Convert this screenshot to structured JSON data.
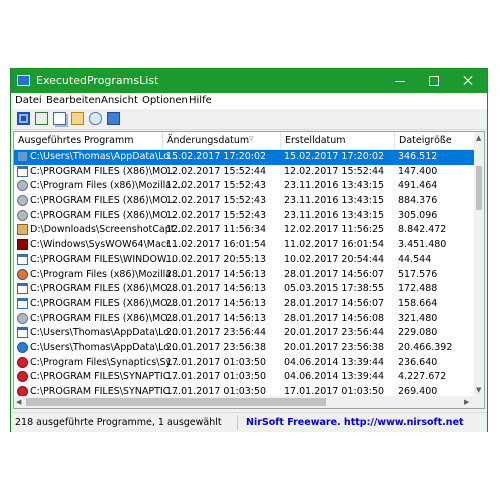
{
  "window": {
    "title": "ExecutedProgramsList"
  },
  "menu": [
    "Datei",
    "Bearbeiten",
    "Ansicht",
    "Optionen",
    "Hilfe"
  ],
  "toolbar": [
    "save-icon",
    "refresh-icon",
    "copy-icon",
    "properties-icon",
    "find-icon",
    "exit-icon"
  ],
  "columns": [
    "Ausgeführtes Programm",
    "Änderungsdatum",
    "Erstelldatum",
    "Dateigröße"
  ],
  "rows": [
    {
      "icon": "folder-icon",
      "name": "C:\\Users\\Thomas\\AppData\\Lo...",
      "modified": "15.02.2017 17:20:02",
      "created": "15.02.2017 17:20:02",
      "size": "346.512",
      "selected": true
    },
    {
      "icon": "window-icon",
      "name": "C:\\PROGRAM FILES (X86)\\MO...",
      "modified": "12.02.2017 15:52:44",
      "created": "12.02.2017 15:52:44",
      "size": "147.400"
    },
    {
      "icon": "gear-icon",
      "name": "C:\\Program Files (x86)\\Mozilla ...",
      "modified": "12.02.2017 15:52:43",
      "created": "23.11.2016 13:43:15",
      "size": "491.464"
    },
    {
      "icon": "gear-icon",
      "name": "C:\\PROGRAM FILES (X86)\\MO...",
      "modified": "12.02.2017 15:52:43",
      "created": "23.11.2016 13:43:15",
      "size": "884.376"
    },
    {
      "icon": "gear-icon",
      "name": "C:\\PROGRAM FILES (X86)\\MO...",
      "modified": "12.02.2017 15:52:43",
      "created": "23.11.2016 13:43:15",
      "size": "305.096"
    },
    {
      "icon": "setup-icon",
      "name": "D:\\Downloads\\ScreenshotCapt...",
      "modified": "12.02.2017 11:56:34",
      "created": "12.02.2017 11:56:25",
      "size": "8.842.472"
    },
    {
      "icon": "macromedia-icon",
      "name": "C:\\Windows\\SysWOW64\\Macr...",
      "modified": "11.02.2017 16:01:54",
      "created": "11.02.2017 16:01:54",
      "size": "3.451.480"
    },
    {
      "icon": "window-icon",
      "name": "C:\\PROGRAM FILES\\WINDOW...",
      "modified": "10.02.2017 20:55:13",
      "created": "10.02.2017 20:54:44",
      "size": "44.544"
    },
    {
      "icon": "firefox-icon",
      "name": "C:\\Program Files (x86)\\Mozilla ...",
      "modified": "28.01.2017 14:56:13",
      "created": "28.01.2017 14:56:07",
      "size": "517.576"
    },
    {
      "icon": "window-icon",
      "name": "C:\\PROGRAM FILES (X86)\\MO...",
      "modified": "28.01.2017 14:56:13",
      "created": "05.03.2015 17:38:55",
      "size": "172.488"
    },
    {
      "icon": "window-icon",
      "name": "C:\\PROGRAM FILES (X86)\\MO...",
      "modified": "28.01.2017 14:56:13",
      "created": "28.01.2017 14:56:07",
      "size": "158.664"
    },
    {
      "icon": "gear-icon",
      "name": "C:\\PROGRAM FILES (X86)\\MO...",
      "modified": "28.01.2017 14:56:13",
      "created": "28.01.2017 14:56:08",
      "size": "321.480"
    },
    {
      "icon": "window-icon",
      "name": "C:\\Users\\Thomas\\AppData\\Lo...",
      "modified": "20.01.2017 23:56:44",
      "created": "20.01.2017 23:56:44",
      "size": "229.080"
    },
    {
      "icon": "cloud-icon",
      "name": "C:\\Users\\Thomas\\AppData\\Lo...",
      "modified": "20.01.2017 23:56:38",
      "created": "20.01.2017 23:56:38",
      "size": "20.466.392"
    },
    {
      "icon": "synaptics-icon",
      "name": "C:\\Program Files\\Synaptics\\Sy...",
      "modified": "17.01.2017 01:03:50",
      "created": "04.06.2014 13:39:44",
      "size": "236.640"
    },
    {
      "icon": "synaptics-icon",
      "name": "C:\\PROGRAM FILES\\SYNAPTIC...",
      "modified": "17.01.2017 01:03:50",
      "created": "04.06.2014 13:39:44",
      "size": "4.227.672"
    },
    {
      "icon": "synaptics-icon",
      "name": "C:\\PROGRAM FILES\\SYNAPTIC...",
      "modified": "17.01.2017 01:03:50",
      "created": "17.01.2017 01:03:50",
      "size": "269.400"
    }
  ],
  "status": {
    "left": "218 ausgeführte Programme, 1 ausgewählt",
    "right": "NirSoft Freeware.  http://www.nirsoft.net"
  },
  "colors": {
    "titlebar": "#1c9a2f",
    "selection": "#0078d7",
    "link": "#0000dd"
  }
}
